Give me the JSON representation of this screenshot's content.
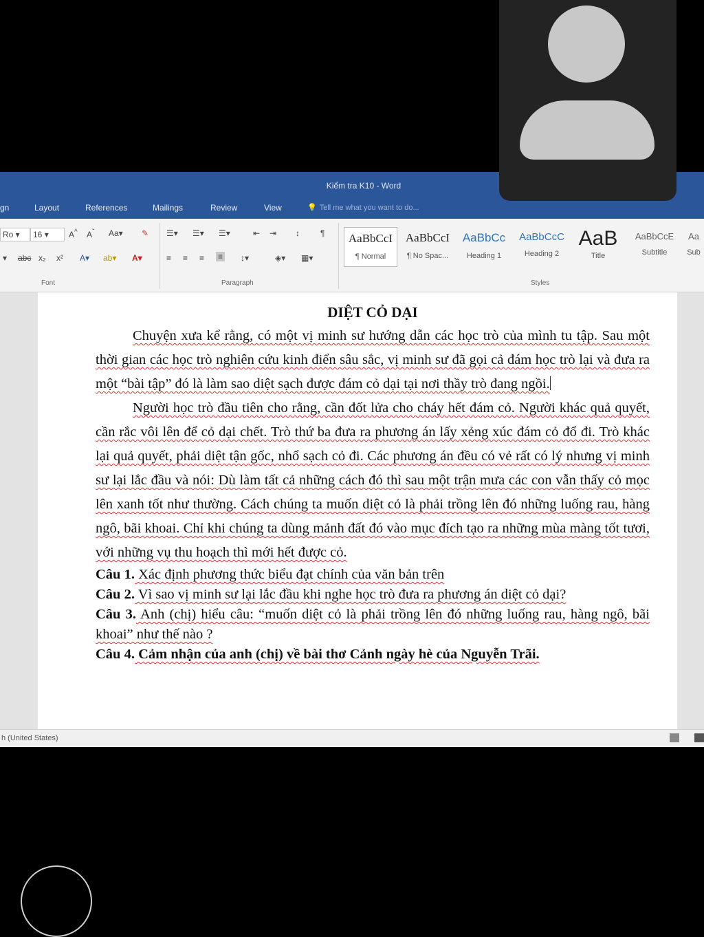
{
  "window": {
    "title": "Kiểm tra K10 - Word"
  },
  "tabs": [
    "gn",
    "Layout",
    "References",
    "Mailings",
    "Review",
    "View"
  ],
  "tell_me": "Tell me what you want to do...",
  "ribbon": {
    "font_name": "Ro",
    "font_size": "16",
    "groups": {
      "font": "Font",
      "paragraph": "Paragraph",
      "styles": "Styles"
    },
    "styles": [
      {
        "preview": "AaBbCcI",
        "name": "¶ Normal"
      },
      {
        "preview": "AaBbCcI",
        "name": "¶ No Spac..."
      },
      {
        "preview": "AaBbCc",
        "name": "Heading 1"
      },
      {
        "preview": "AaBbCcC",
        "name": "Heading 2"
      },
      {
        "preview": "AaB",
        "name": "Title"
      },
      {
        "preview": "AaBbCcE",
        "name": "Subtitle"
      },
      {
        "preview": "Aa",
        "name": "Sub"
      }
    ]
  },
  "document": {
    "title": "DIỆT CỎ DẠI",
    "paragraph_1": "Chuyện xưa kể rằng, có một vị minh sư hướng dẫn các học trò của mình tu tập. Sau một thời gian các học trò nghiên cứu kinh điển sâu sắc, vị minh sư đã gọi cả đám học trò lại và đưa ra một “bài tập” đó là làm sao diệt sạch được đám cỏ dại tại nơi thầy trò đang ngồi.",
    "paragraph_2": "Người học trò đầu tiên cho rằng, cần đốt lửa cho cháy hết đám cỏ. Người khác quả quyết, cần rắc vôi lên để cỏ dại chết. Trò thứ ba đưa ra phương án lấy xẻng xúc đám cỏ đổ đi. Trò khác lại quả quyết, phải diệt tận gốc, nhổ sạch cỏ đi. Các phương án đều có vẻ rất có lý nhưng vị minh sư lại lắc đầu và nói: Dù làm tất cả những cách đó thì sau một trận mưa các con vẫn thấy cỏ mọc lên xanh tốt như thường. Cách chúng ta muốn diệt cỏ là phải trồng lên đó những luống rau, hàng ngô, bãi khoai. Chỉ khi chúng ta dùng mảnh đất đó vào mục đích tạo ra những mùa màng tốt tươi, với những vụ thu hoạch thì mới hết được cỏ.",
    "questions": [
      {
        "label": "Câu 1.",
        "text": " Xác định phương thức biểu đạt chính của văn bản trên"
      },
      {
        "label": "Câu 2.",
        "text": " Vì sao vị minh sư lại lắc đầu khi nghe học trò đưa ra phương án diệt cỏ dại?"
      },
      {
        "label": "Câu 3.",
        "text": " Anh (chị) hiểu câu: “muốn diệt cỏ là phải trồng lên đó những luống rau, hàng ngô, bãi khoai” như thế nào ?"
      },
      {
        "label": "Câu 4.",
        "text": " Cảm nhận của anh (chị) về bài thơ Cảnh ngày hè của Nguyễn Trãi."
      }
    ]
  },
  "status": {
    "language": "h (United States)"
  },
  "colors": {
    "title_bar": "#2b579a",
    "spell_underline": "#d33"
  }
}
